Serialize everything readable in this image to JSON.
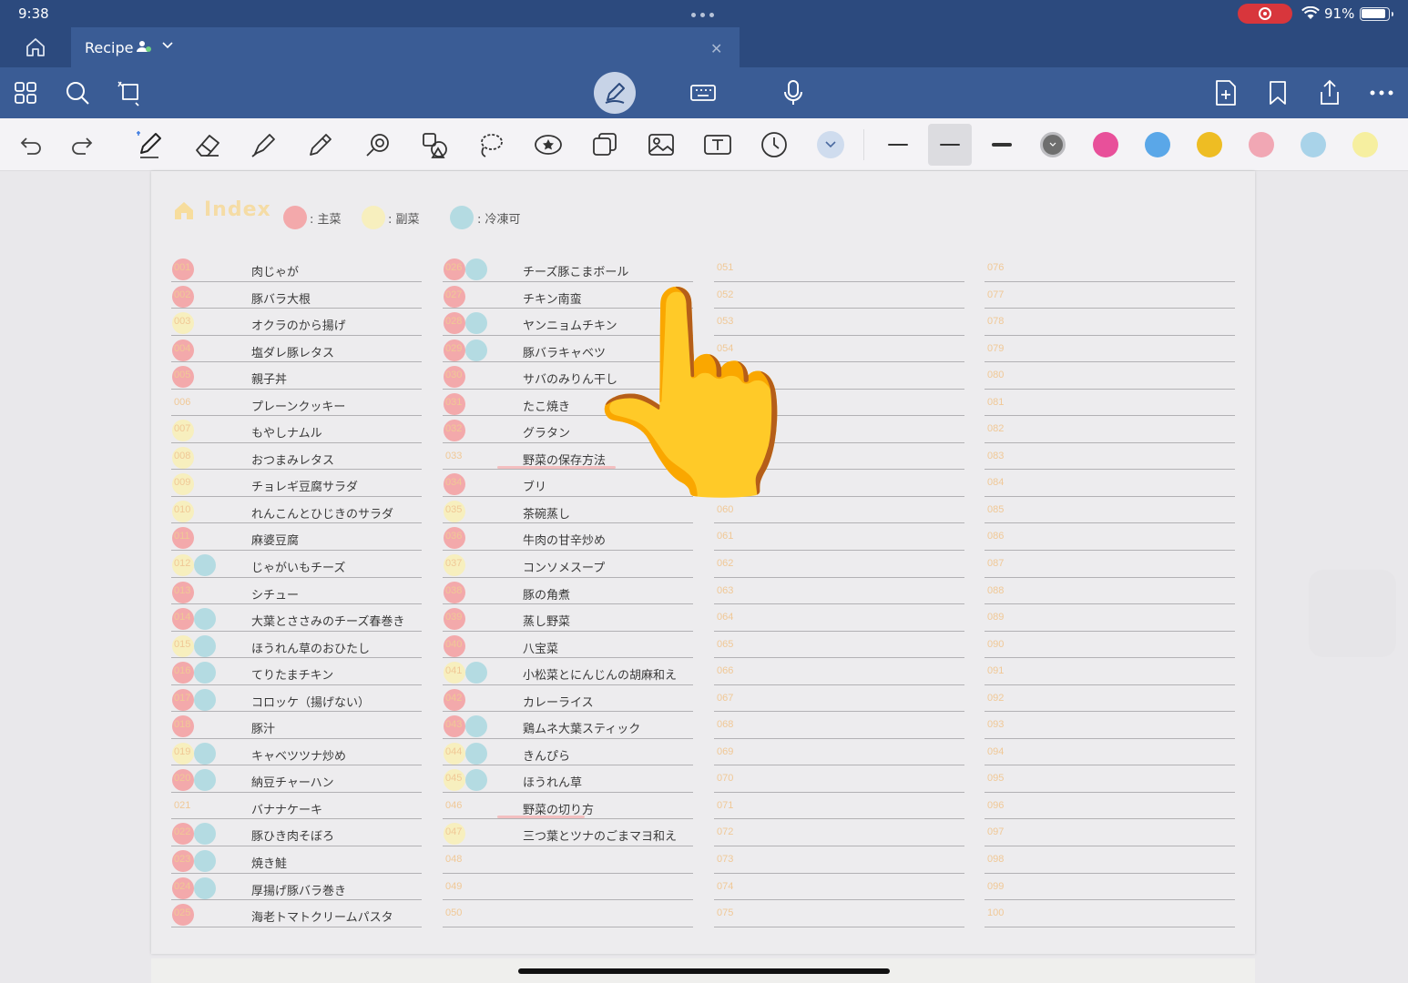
{
  "status": {
    "time": "9:38",
    "battery": "91%"
  },
  "tab": {
    "title": "Recipe"
  },
  "page": {
    "title": "Index",
    "legend": [
      {
        "label": ": 主菜",
        "color": "#f3a9ab"
      },
      {
        "label": ": 副菜",
        "color": "#f7efbe"
      },
      {
        "label": ": 冷凍可",
        "color": "#b4dbe2"
      }
    ]
  },
  "colors": {
    "main_dish": "#f3a9ab",
    "side_dish": "#f7efbe",
    "freezable": "#b4dbe2",
    "accent": "#3a5c95",
    "topbar": "#2c4a7e",
    "number_text": "#f0c896"
  },
  "palette": [
    "#6e6e6e",
    "#e8509a",
    "#5aa7e8",
    "#eebd23",
    "#f1a7b4",
    "#a9d3e9",
    "#f6efa0"
  ],
  "icons": {
    "home": "home-icon",
    "grid": "grid-icon",
    "search": "search-icon",
    "shape": "shape-icon",
    "pen_mode": "pen-mode-icon",
    "keyboard": "keyboard-icon",
    "mic": "mic-icon",
    "add_page": "add-page-icon",
    "bookmark": "bookmark-icon",
    "share": "share-icon",
    "more": "more-icon",
    "overlay": "pointing-hand-emoji"
  },
  "overlay": {
    "emoji": "👆"
  },
  "columns": [
    {
      "items": [
        {
          "no": "001",
          "name": "肉じゃが",
          "main": true
        },
        {
          "no": "002",
          "name": "豚バラ大根",
          "main": true
        },
        {
          "no": "003",
          "name": "オクラのから揚げ",
          "side": true
        },
        {
          "no": "004",
          "name": "塩ダレ豚レタス",
          "main": true
        },
        {
          "no": "005",
          "name": "親子丼",
          "main": true
        },
        {
          "no": "006",
          "name": "プレーンクッキー"
        },
        {
          "no": "007",
          "name": "もやしナムル",
          "side": true
        },
        {
          "no": "008",
          "name": "おつまみレタス",
          "side": true
        },
        {
          "no": "009",
          "name": "チョレギ豆腐サラダ",
          "side": true
        },
        {
          "no": "010",
          "name": "れんこんとひじきのサラダ",
          "side": true
        },
        {
          "no": "011",
          "name": "麻婆豆腐",
          "main": true
        },
        {
          "no": "012",
          "name": "じゃがいもチーズ",
          "side": true,
          "freeze": true
        },
        {
          "no": "013",
          "name": "シチュー",
          "main": true
        },
        {
          "no": "014",
          "name": "大葉とささみのチーズ春巻き",
          "main": true,
          "freeze": true
        },
        {
          "no": "015",
          "name": "ほうれん草のおひたし",
          "side": true,
          "freeze": true
        },
        {
          "no": "016",
          "name": "てりたまチキン",
          "main": true,
          "freeze": true
        },
        {
          "no": "017",
          "name": "コロッケ（揚げない）",
          "main": true,
          "freeze": true
        },
        {
          "no": "018",
          "name": "豚汁",
          "main": true
        },
        {
          "no": "019",
          "name": "キャベツツナ炒め",
          "side": true,
          "freeze": true
        },
        {
          "no": "020",
          "name": "納豆チャーハン",
          "main": true,
          "freeze": true
        },
        {
          "no": "021",
          "name": "バナナケーキ"
        },
        {
          "no": "022",
          "name": "豚ひき肉そぼろ",
          "main": true,
          "freeze": true
        },
        {
          "no": "023",
          "name": "焼き鮭",
          "main": true,
          "freeze": true
        },
        {
          "no": "024",
          "name": "厚揚げ豚バラ巻き",
          "main": true,
          "freeze": true
        },
        {
          "no": "025",
          "name": "海老トマトクリームパスタ",
          "main": true
        }
      ]
    },
    {
      "items": [
        {
          "no": "026",
          "name": "チーズ豚こまボール",
          "main": true,
          "freeze": true
        },
        {
          "no": "027",
          "name": "チキン南蛮",
          "main": true
        },
        {
          "no": "028",
          "name": "ヤンニョムチキン",
          "main": true,
          "freeze": true
        },
        {
          "no": "029",
          "name": "豚バラキャベツ",
          "main": true,
          "freeze": true
        },
        {
          "no": "030",
          "name": "サバのみりん干し",
          "main": true
        },
        {
          "no": "031",
          "name": "たこ焼き",
          "main": true
        },
        {
          "no": "032",
          "name": "グラタン",
          "main": true
        },
        {
          "no": "033",
          "name": "野菜の保存方法",
          "hl": 130
        },
        {
          "no": "034",
          "name": "ブリ",
          "main": true
        },
        {
          "no": "035",
          "name": "茶碗蒸し",
          "side": true
        },
        {
          "no": "036",
          "name": "牛肉の甘辛炒め",
          "main": true
        },
        {
          "no": "037",
          "name": "コンソメスープ",
          "side": true
        },
        {
          "no": "038",
          "name": "豚の角煮",
          "main": true
        },
        {
          "no": "039",
          "name": "蒸し野菜",
          "main": true
        },
        {
          "no": "040",
          "name": "八宝菜",
          "main": true
        },
        {
          "no": "041",
          "name": "小松菜とにんじんの胡麻和え",
          "side": true,
          "freeze": true
        },
        {
          "no": "042",
          "name": "カレーライス",
          "main": true
        },
        {
          "no": "043",
          "name": "鶏ムネ大葉スティック",
          "main": true,
          "freeze": true
        },
        {
          "no": "044",
          "name": "きんぴら",
          "side": true,
          "freeze": true
        },
        {
          "no": "045",
          "name": "ほうれん草",
          "side": true,
          "freeze": true
        },
        {
          "no": "046",
          "name": "野菜の切り方",
          "hl": 96
        },
        {
          "no": "047",
          "name": "三つ葉とツナのごまマヨ和え",
          "side": true
        },
        {
          "no": "048",
          "name": ""
        },
        {
          "no": "049",
          "name": ""
        },
        {
          "no": "050",
          "name": ""
        }
      ]
    },
    {
      "items": [
        {
          "no": "051",
          "name": ""
        },
        {
          "no": "052",
          "name": ""
        },
        {
          "no": "053",
          "name": ""
        },
        {
          "no": "054",
          "name": ""
        },
        {
          "no": "055",
          "name": ""
        },
        {
          "no": "056",
          "name": ""
        },
        {
          "no": "057",
          "name": ""
        },
        {
          "no": "058",
          "name": ""
        },
        {
          "no": "059",
          "name": ""
        },
        {
          "no": "060",
          "name": ""
        },
        {
          "no": "061",
          "name": ""
        },
        {
          "no": "062",
          "name": ""
        },
        {
          "no": "063",
          "name": ""
        },
        {
          "no": "064",
          "name": ""
        },
        {
          "no": "065",
          "name": ""
        },
        {
          "no": "066",
          "name": ""
        },
        {
          "no": "067",
          "name": ""
        },
        {
          "no": "068",
          "name": ""
        },
        {
          "no": "069",
          "name": ""
        },
        {
          "no": "070",
          "name": ""
        },
        {
          "no": "071",
          "name": ""
        },
        {
          "no": "072",
          "name": ""
        },
        {
          "no": "073",
          "name": ""
        },
        {
          "no": "074",
          "name": ""
        },
        {
          "no": "075",
          "name": ""
        }
      ]
    },
    {
      "items": [
        {
          "no": "076",
          "name": ""
        },
        {
          "no": "077",
          "name": ""
        },
        {
          "no": "078",
          "name": ""
        },
        {
          "no": "079",
          "name": ""
        },
        {
          "no": "080",
          "name": ""
        },
        {
          "no": "081",
          "name": ""
        },
        {
          "no": "082",
          "name": ""
        },
        {
          "no": "083",
          "name": ""
        },
        {
          "no": "084",
          "name": ""
        },
        {
          "no": "085",
          "name": ""
        },
        {
          "no": "086",
          "name": ""
        },
        {
          "no": "087",
          "name": ""
        },
        {
          "no": "088",
          "name": ""
        },
        {
          "no": "089",
          "name": ""
        },
        {
          "no": "090",
          "name": ""
        },
        {
          "no": "091",
          "name": ""
        },
        {
          "no": "092",
          "name": ""
        },
        {
          "no": "093",
          "name": ""
        },
        {
          "no": "094",
          "name": ""
        },
        {
          "no": "095",
          "name": ""
        },
        {
          "no": "096",
          "name": ""
        },
        {
          "no": "097",
          "name": ""
        },
        {
          "no": "098",
          "name": ""
        },
        {
          "no": "099",
          "name": ""
        },
        {
          "no": "100",
          "name": ""
        }
      ]
    }
  ]
}
